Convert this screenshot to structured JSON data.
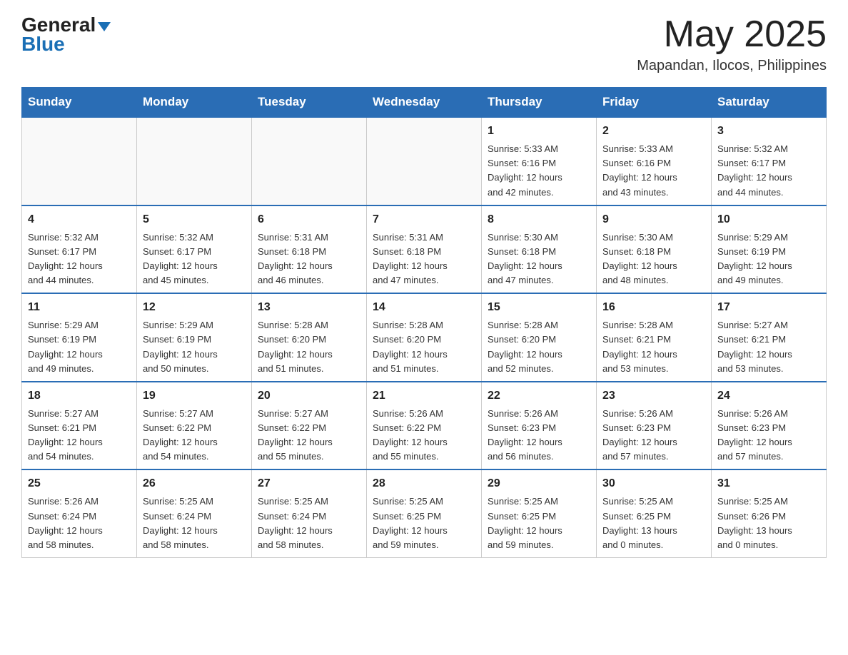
{
  "header": {
    "month_title": "May 2025",
    "location": "Mapandan, Ilocos, Philippines"
  },
  "logo": {
    "general": "General",
    "blue": "Blue"
  },
  "days": [
    "Sunday",
    "Monday",
    "Tuesday",
    "Wednesday",
    "Thursday",
    "Friday",
    "Saturday"
  ],
  "weeks": [
    [
      {
        "day": "",
        "info": ""
      },
      {
        "day": "",
        "info": ""
      },
      {
        "day": "",
        "info": ""
      },
      {
        "day": "",
        "info": ""
      },
      {
        "day": "1",
        "info": "Sunrise: 5:33 AM\nSunset: 6:16 PM\nDaylight: 12 hours\nand 42 minutes."
      },
      {
        "day": "2",
        "info": "Sunrise: 5:33 AM\nSunset: 6:16 PM\nDaylight: 12 hours\nand 43 minutes."
      },
      {
        "day": "3",
        "info": "Sunrise: 5:32 AM\nSunset: 6:17 PM\nDaylight: 12 hours\nand 44 minutes."
      }
    ],
    [
      {
        "day": "4",
        "info": "Sunrise: 5:32 AM\nSunset: 6:17 PM\nDaylight: 12 hours\nand 44 minutes."
      },
      {
        "day": "5",
        "info": "Sunrise: 5:32 AM\nSunset: 6:17 PM\nDaylight: 12 hours\nand 45 minutes."
      },
      {
        "day": "6",
        "info": "Sunrise: 5:31 AM\nSunset: 6:18 PM\nDaylight: 12 hours\nand 46 minutes."
      },
      {
        "day": "7",
        "info": "Sunrise: 5:31 AM\nSunset: 6:18 PM\nDaylight: 12 hours\nand 47 minutes."
      },
      {
        "day": "8",
        "info": "Sunrise: 5:30 AM\nSunset: 6:18 PM\nDaylight: 12 hours\nand 47 minutes."
      },
      {
        "day": "9",
        "info": "Sunrise: 5:30 AM\nSunset: 6:18 PM\nDaylight: 12 hours\nand 48 minutes."
      },
      {
        "day": "10",
        "info": "Sunrise: 5:29 AM\nSunset: 6:19 PM\nDaylight: 12 hours\nand 49 minutes."
      }
    ],
    [
      {
        "day": "11",
        "info": "Sunrise: 5:29 AM\nSunset: 6:19 PM\nDaylight: 12 hours\nand 49 minutes."
      },
      {
        "day": "12",
        "info": "Sunrise: 5:29 AM\nSunset: 6:19 PM\nDaylight: 12 hours\nand 50 minutes."
      },
      {
        "day": "13",
        "info": "Sunrise: 5:28 AM\nSunset: 6:20 PM\nDaylight: 12 hours\nand 51 minutes."
      },
      {
        "day": "14",
        "info": "Sunrise: 5:28 AM\nSunset: 6:20 PM\nDaylight: 12 hours\nand 51 minutes."
      },
      {
        "day": "15",
        "info": "Sunrise: 5:28 AM\nSunset: 6:20 PM\nDaylight: 12 hours\nand 52 minutes."
      },
      {
        "day": "16",
        "info": "Sunrise: 5:28 AM\nSunset: 6:21 PM\nDaylight: 12 hours\nand 53 minutes."
      },
      {
        "day": "17",
        "info": "Sunrise: 5:27 AM\nSunset: 6:21 PM\nDaylight: 12 hours\nand 53 minutes."
      }
    ],
    [
      {
        "day": "18",
        "info": "Sunrise: 5:27 AM\nSunset: 6:21 PM\nDaylight: 12 hours\nand 54 minutes."
      },
      {
        "day": "19",
        "info": "Sunrise: 5:27 AM\nSunset: 6:22 PM\nDaylight: 12 hours\nand 54 minutes."
      },
      {
        "day": "20",
        "info": "Sunrise: 5:27 AM\nSunset: 6:22 PM\nDaylight: 12 hours\nand 55 minutes."
      },
      {
        "day": "21",
        "info": "Sunrise: 5:26 AM\nSunset: 6:22 PM\nDaylight: 12 hours\nand 55 minutes."
      },
      {
        "day": "22",
        "info": "Sunrise: 5:26 AM\nSunset: 6:23 PM\nDaylight: 12 hours\nand 56 minutes."
      },
      {
        "day": "23",
        "info": "Sunrise: 5:26 AM\nSunset: 6:23 PM\nDaylight: 12 hours\nand 57 minutes."
      },
      {
        "day": "24",
        "info": "Sunrise: 5:26 AM\nSunset: 6:23 PM\nDaylight: 12 hours\nand 57 minutes."
      }
    ],
    [
      {
        "day": "25",
        "info": "Sunrise: 5:26 AM\nSunset: 6:24 PM\nDaylight: 12 hours\nand 58 minutes."
      },
      {
        "day": "26",
        "info": "Sunrise: 5:25 AM\nSunset: 6:24 PM\nDaylight: 12 hours\nand 58 minutes."
      },
      {
        "day": "27",
        "info": "Sunrise: 5:25 AM\nSunset: 6:24 PM\nDaylight: 12 hours\nand 58 minutes."
      },
      {
        "day": "28",
        "info": "Sunrise: 5:25 AM\nSunset: 6:25 PM\nDaylight: 12 hours\nand 59 minutes."
      },
      {
        "day": "29",
        "info": "Sunrise: 5:25 AM\nSunset: 6:25 PM\nDaylight: 12 hours\nand 59 minutes."
      },
      {
        "day": "30",
        "info": "Sunrise: 5:25 AM\nSunset: 6:25 PM\nDaylight: 13 hours\nand 0 minutes."
      },
      {
        "day": "31",
        "info": "Sunrise: 5:25 AM\nSunset: 6:26 PM\nDaylight: 13 hours\nand 0 minutes."
      }
    ]
  ]
}
